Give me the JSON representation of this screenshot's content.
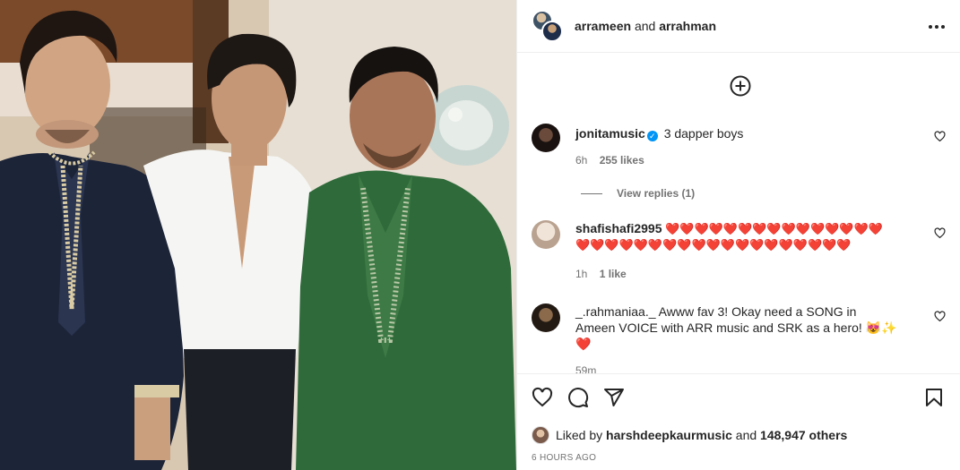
{
  "header": {
    "user1": "arrameen",
    "conjunction": "and",
    "user2": "arrahman",
    "more_icon": "more-horizontal-icon"
  },
  "comments": [
    {
      "username": "jonitamusic",
      "verified": true,
      "text": "3 dapper boys",
      "time": "6h",
      "likes": "255 likes",
      "view_replies": "View replies (1)"
    },
    {
      "username": "shafishafi2995",
      "text_line1": "❤️❤️❤️❤️❤️❤️❤️❤️❤️❤️❤️❤️❤️❤️❤️",
      "text_line2": "❤️❤️❤️❤️❤️❤️❤️❤️❤️❤️❤️❤️❤️❤️❤️❤️❤️❤️❤️",
      "time": "1h",
      "likes": "1 like"
    },
    {
      "username": "_.rahmaniaa._",
      "text": "Awww fav 3! Okay need a SONG in Ameen VOICE with ARR music and SRK as a hero! 😻✨❤️",
      "time": "59m"
    }
  ],
  "footer": {
    "liked_prefix": "Liked by",
    "liked_user": "harshdeepkaurmusic",
    "liked_and": "and",
    "liked_others": "148,947 others",
    "time_ago": "6 HOURS AGO"
  },
  "colors": {
    "verified": "#0095f6",
    "secondary_text": "#737373",
    "divider": "#efefef"
  }
}
